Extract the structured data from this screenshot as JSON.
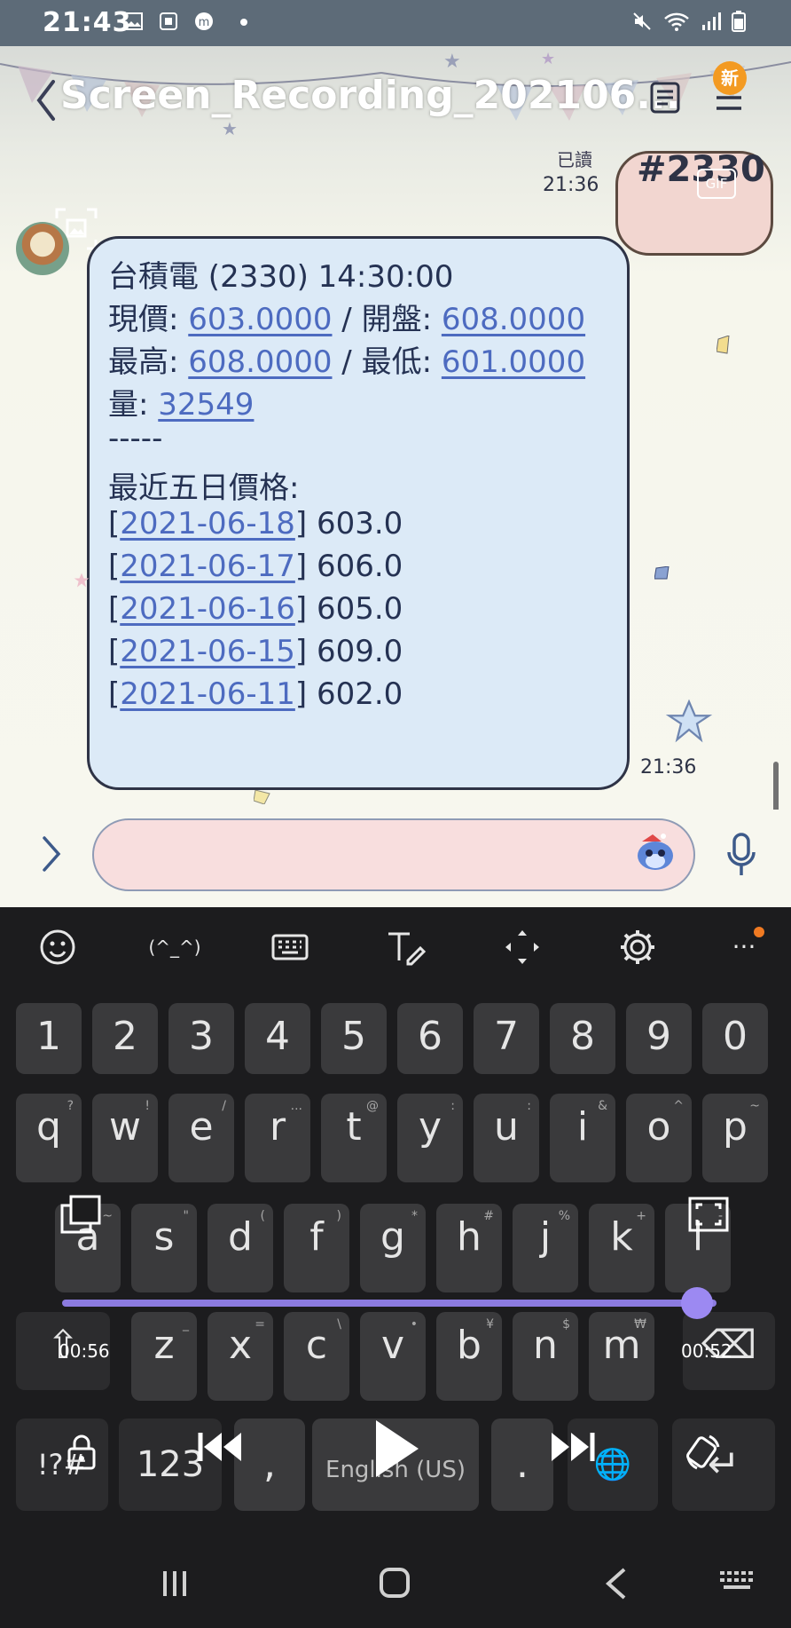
{
  "status_bar": {
    "time": "21:43"
  },
  "header": {
    "title": "Screen_Recording_202106...",
    "new_badge": "新"
  },
  "sent_message": {
    "text": "#2330",
    "read_label": "已讀",
    "time": "21:36",
    "gif_badge": "GIF"
  },
  "received_message": {
    "line1": "台積電 (2330) 14:30:00",
    "price_label": "現價: ",
    "price_value": "603.0000",
    "open_sep": " / ",
    "open_label": "開盤: ",
    "open_value": "608.0000",
    "high_label": "最高: ",
    "high_value": "608.0000",
    "low_sep": " / ",
    "low_label": "最低: ",
    "low_value": "601.0000",
    "volume_label": "量: ",
    "volume_value": "32549",
    "divider": "-----",
    "history_title": "最近五日價格:",
    "history": [
      {
        "date": "2021-06-18",
        "price": "603.0"
      },
      {
        "date": "2021-06-17",
        "price": "606.0"
      },
      {
        "date": "2021-06-16",
        "price": "605.0"
      },
      {
        "date": "2021-06-15",
        "price": "609.0"
      },
      {
        "date": "2021-06-11",
        "price": "602.0"
      }
    ],
    "time": "21:36"
  },
  "input": {
    "placeholder": ""
  },
  "keyboard": {
    "toolbar": [
      "emoji-icon",
      "kaomoji",
      "keyboard-icon",
      "handwriting-icon",
      "move-icon",
      "settings-icon",
      "more-icon"
    ],
    "kaomoji": "(^_^)",
    "more": "···",
    "row_numbers": [
      "1",
      "2",
      "3",
      "4",
      "5",
      "6",
      "7",
      "8",
      "9",
      "0"
    ],
    "row1": [
      "q",
      "w",
      "e",
      "r",
      "t",
      "y",
      "u",
      "i",
      "o",
      "p"
    ],
    "row1_hints": [
      "?",
      "!",
      "/",
      "...",
      "@",
      ":",
      ":",
      "&",
      "^",
      "~"
    ],
    "row2": [
      "a",
      "s",
      "d",
      "f",
      "g",
      "h",
      "j",
      "k",
      "l"
    ],
    "row2_hints": [
      "~",
      "\"",
      "(",
      ")",
      "*",
      "#",
      "%",
      "+",
      "-"
    ],
    "row3": [
      "z",
      "x",
      "c",
      "v",
      "b",
      "n",
      "m"
    ],
    "row3_hints": [
      "_",
      "=",
      "\\",
      "•",
      "¥",
      "$",
      "₩"
    ],
    "shift": "⇧",
    "backspace": "⌫",
    "sym": "!?#",
    "num": "123",
    "comma": ",",
    "space": "English (US)",
    "period": ".",
    "enter": "↵",
    "globe": "🌐"
  },
  "video_overlay": {
    "elapsed": "00:56",
    "remaining": "00:52",
    "progress": 0.97
  }
}
